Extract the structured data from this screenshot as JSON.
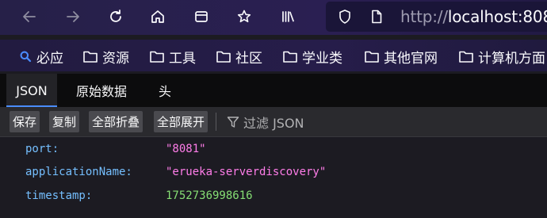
{
  "browser": {
    "url_protocol": "http://",
    "url_host": "localhost:808"
  },
  "bookmarks": [
    {
      "label": "必应",
      "icon": "search-icon"
    },
    {
      "label": "资源",
      "icon": "folder-icon"
    },
    {
      "label": "工具",
      "icon": "folder-icon"
    },
    {
      "label": "社区",
      "icon": "folder-icon"
    },
    {
      "label": "学业类",
      "icon": "folder-icon"
    },
    {
      "label": "其他官网",
      "icon": "folder-icon"
    },
    {
      "label": "计算机方面",
      "icon": "folder-icon"
    }
  ],
  "viewer_tabs": {
    "json": "JSON",
    "raw": "原始数据",
    "headers": "头"
  },
  "json_toolbar": {
    "save": "保存",
    "copy": "复制",
    "collapse_all": "全部折叠",
    "expand_all": "全部展开",
    "filter": "过滤 JSON"
  },
  "json_rows": [
    {
      "key": "port:",
      "value": "\"8081\"",
      "type": "string"
    },
    {
      "key": "applicationName:",
      "value": "\"erueka-serverdiscovery\"",
      "type": "string"
    },
    {
      "key": "timestamp:",
      "value": "1752736998616",
      "type": "number"
    }
  ],
  "colors": {
    "key": "#75bfff",
    "string": "#ff7de9",
    "number": "#86de74",
    "active_tab_underline": "#4a8cff"
  }
}
